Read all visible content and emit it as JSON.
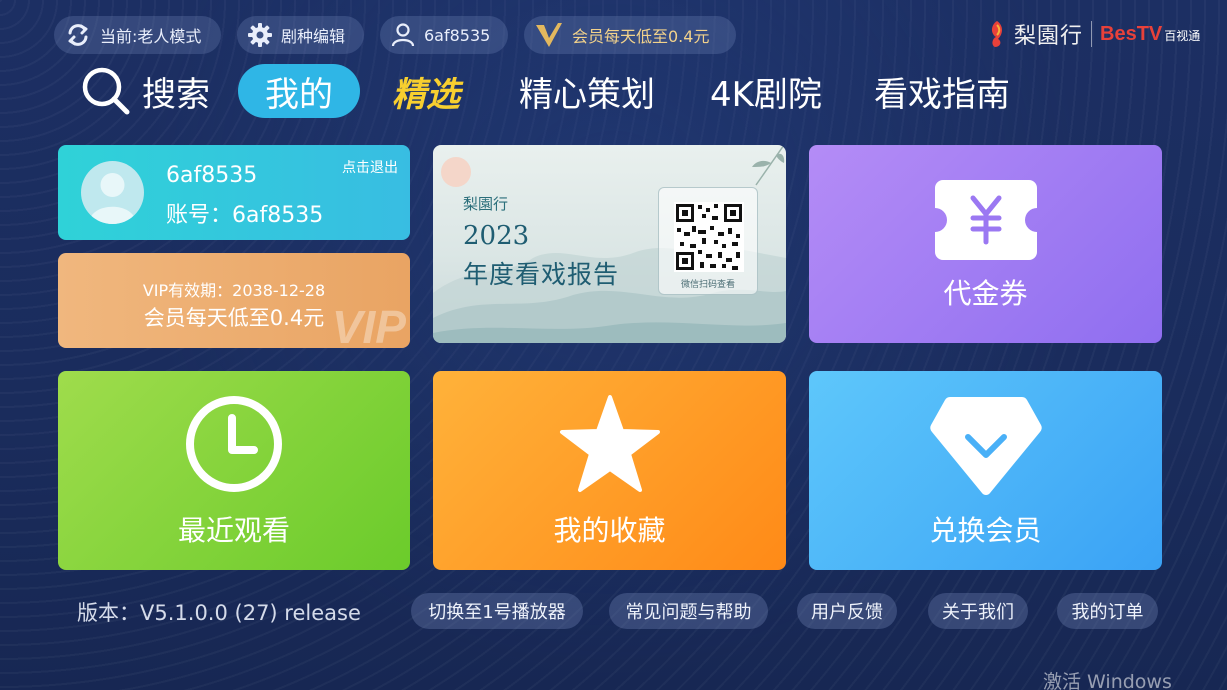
{
  "top_bar": {
    "mode": "当前:老人模式",
    "genre_edit": "剧种编辑",
    "user": "6af8535",
    "vip_promo": "会员每天低至0.4元"
  },
  "logo": {
    "brand_cn": "梨園行",
    "partner": "BesTV",
    "partner_sub": "百视通"
  },
  "nav": {
    "search": "搜索",
    "mine": "我的",
    "featured": "精选",
    "curated": "精心策划",
    "theater_4k": "4K剧院",
    "guide": "看戏指南"
  },
  "profile": {
    "name": "6af8535",
    "account": "账号：6af8535",
    "logout": "点击退出"
  },
  "vip": {
    "expire": "VIP有效期：2038-12-28",
    "price": "会员每天低至0.4元",
    "mark": "VIP"
  },
  "report": {
    "brand": "梨園行",
    "year": "2023",
    "title": "年度看戏报告",
    "qr_caption": "微信扫码查看"
  },
  "tiles": {
    "coupon": "代金券",
    "recent": "最近观看",
    "favorites": "我的收藏",
    "redeem": "兑换会员"
  },
  "footer": {
    "version": "版本：V5.1.0.0 (27) release",
    "switch_player": "切换至1号播放器",
    "faq": "常见问题与帮助",
    "feedback": "用户反馈",
    "about": "关于我们",
    "orders": "我的订单"
  },
  "watermark": "激活 Windows",
  "colors": {
    "background": "#1c2f63",
    "nav_active": "#2fb6e6",
    "nav_featured": "#f8cf2f",
    "vip_gold": "#f2d28b"
  }
}
